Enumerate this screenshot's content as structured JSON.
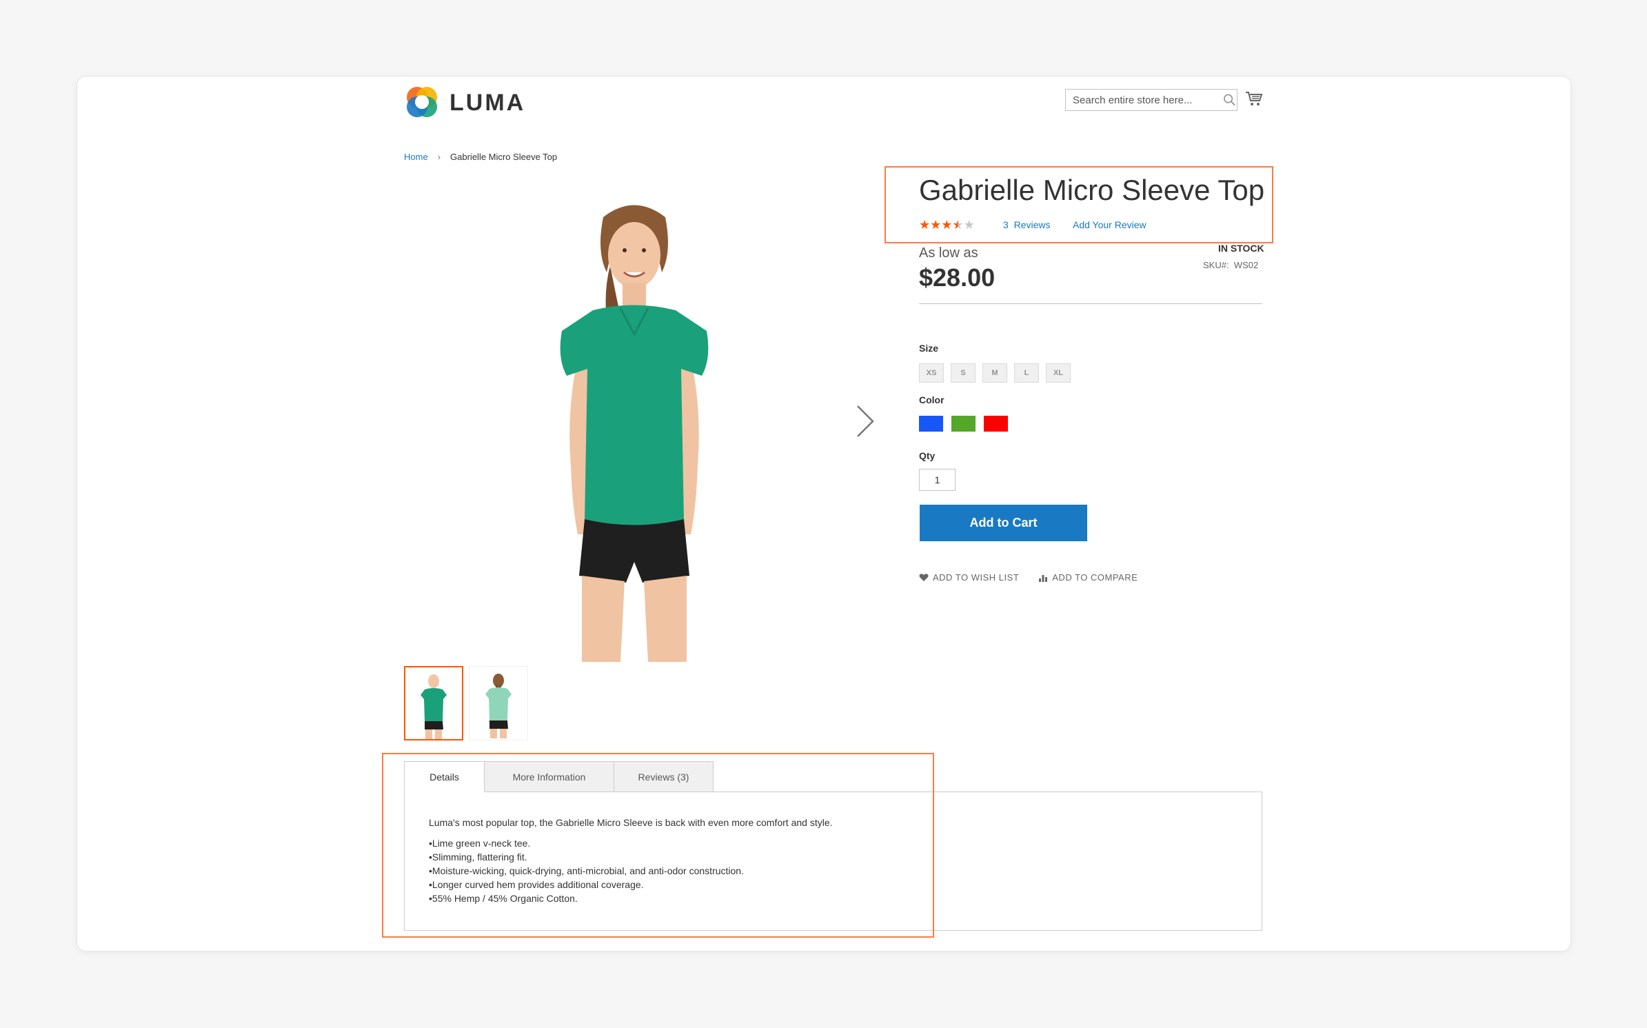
{
  "header": {
    "logo_text": "LUMA",
    "search_placeholder": "Search entire store here..."
  },
  "breadcrumb": {
    "home": "Home",
    "separator": "›",
    "current": "Gabrielle Micro Sleeve Top"
  },
  "product": {
    "name": "Gabrielle Micro Sleeve Top",
    "rating_stars": 3.5,
    "rating_max": 5,
    "review_count_label": "3  Reviews",
    "add_review_label": "Add Your Review",
    "price_prefix": "As low as",
    "price": "$28.00",
    "stock_status": "IN STOCK",
    "sku_label": "SKU#:  WS02",
    "size_label": "Size",
    "sizes": [
      "XS",
      "S",
      "M",
      "L",
      "XL"
    ],
    "color_label": "Color",
    "colors": [
      "#1857f7",
      "#53a828",
      "#ff0000"
    ],
    "qty_label": "Qty",
    "qty_value": "1",
    "add_to_cart_label": "Add to Cart",
    "wishlist_label": "ADD TO WISH LIST",
    "compare_label": "ADD TO COMPARE",
    "shirt_color": "#1aa17b"
  },
  "tabs": {
    "details": "Details",
    "more_info": "More Information",
    "reviews": "Reviews (3)",
    "description": "Luma's most popular top, the Gabrielle Micro Sleeve is back with even more comfort and style.",
    "bullets": [
      "Lime green v-neck tee.",
      "Slimming, flattering fit.",
      "Moisture-wicking, quick-drying, anti-microbial, and anti-odor construction.",
      "Longer curved hem provides additional coverage.",
      "55% Hemp / 45% Organic Cotton."
    ]
  },
  "colors": {
    "accent_orange": "#ff5501",
    "link_blue": "#1979c3",
    "button_blue": "#1979c3"
  }
}
